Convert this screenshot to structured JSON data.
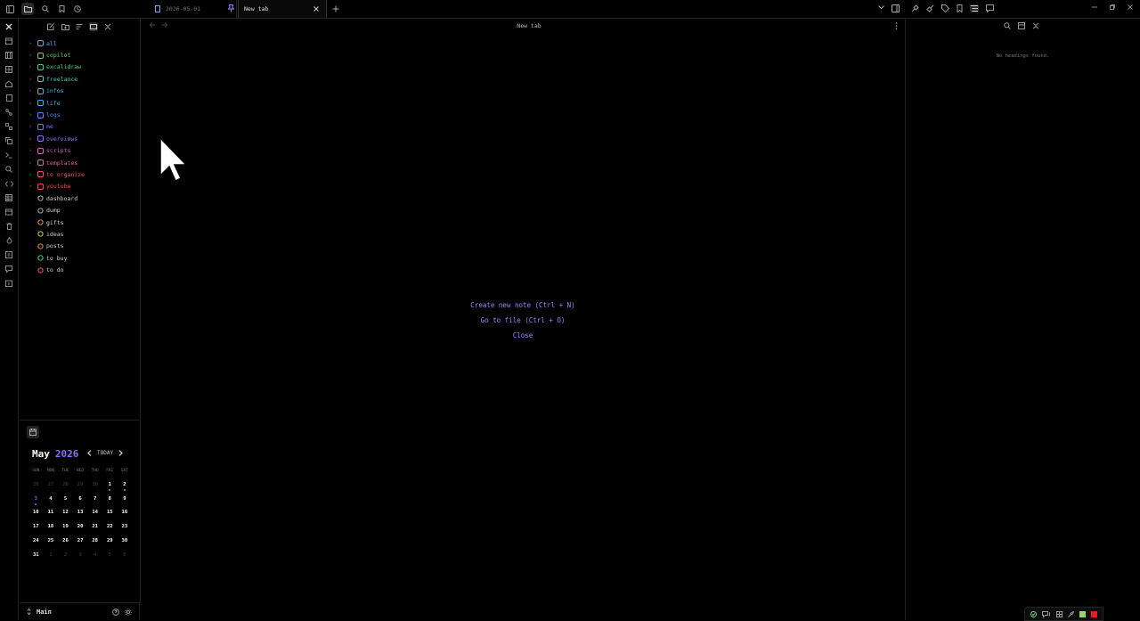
{
  "tabs": [
    {
      "label": "2026-05-01",
      "active": false
    },
    {
      "label": "New tab",
      "active": true
    }
  ],
  "main": {
    "title": "New tab",
    "actions": [
      "Create new note (Ctrl + N)",
      "Go to file (Ctrl + O)",
      "Close"
    ]
  },
  "explorer": {
    "folders": [
      {
        "label": "all",
        "color": "#3fb4f5",
        "icon": "globe-icon"
      },
      {
        "label": "copilot",
        "color": "#5fd17a",
        "icon": "folder-icon"
      },
      {
        "label": "excalidraw",
        "color": "#46d07a",
        "icon": "pencil-icon"
      },
      {
        "label": "freelance",
        "color": "#3ecfc1",
        "icon": "briefcase-icon"
      },
      {
        "label": "infos",
        "color": "#3fb4f5",
        "icon": "info-icon"
      },
      {
        "label": "life",
        "color": "#3fb4f5",
        "icon": "leaf-icon"
      },
      {
        "label": "logs",
        "color": "#4c8dff",
        "icon": "log-icon"
      },
      {
        "label": "me",
        "color": "#7b6cff",
        "icon": "person-icon"
      },
      {
        "label": "overviews",
        "color": "#9a6cff",
        "icon": "mountain-icon"
      },
      {
        "label": "scripts",
        "color": "#d75ed4",
        "icon": "code-icon"
      },
      {
        "label": "templates",
        "color": "#f15ba0",
        "icon": "template-icon"
      },
      {
        "label": "to organize",
        "color": "#f5506f",
        "icon": "shuffle-icon"
      },
      {
        "label": "youtube",
        "color": "#f24848",
        "icon": "video-icon"
      }
    ],
    "files": [
      {
        "label": "dashboard",
        "icon": "dashboard-icon",
        "icon_color": "#aaaaaa"
      },
      {
        "label": "dump",
        "icon": "speech-icon",
        "icon_color": "#aaaaaa"
      },
      {
        "label": "gifts",
        "icon": "gift-icon",
        "icon_color": "#f08a3a"
      },
      {
        "label": "ideas",
        "icon": "bulb-icon",
        "icon_color": "#d6c13a"
      },
      {
        "label": "posts",
        "icon": "at-icon",
        "icon_color": "#f08a3a"
      },
      {
        "label": "to buy",
        "icon": "receipt-icon",
        "icon_color": "#3fcf6b"
      },
      {
        "label": "to do",
        "icon": "target-icon",
        "icon_color": "#f5506f"
      }
    ],
    "file_color": "#cfcfcf"
  },
  "calendar": {
    "month": "May",
    "year": "2026",
    "today_label": "TODAY",
    "weekdays": [
      "SUN",
      "MON",
      "TUE",
      "WED",
      "THU",
      "FRI",
      "SAT"
    ],
    "weeks": [
      [
        "26",
        "27",
        "28",
        "29",
        "30",
        "1",
        "2"
      ],
      [
        "3",
        "4",
        "5",
        "6",
        "7",
        "8",
        "9"
      ],
      [
        "10",
        "11",
        "12",
        "13",
        "14",
        "15",
        "16"
      ],
      [
        "17",
        "18",
        "19",
        "20",
        "21",
        "22",
        "23"
      ],
      [
        "24",
        "25",
        "26",
        "27",
        "28",
        "29",
        "30"
      ],
      [
        "31",
        "1",
        "2",
        "3",
        "4",
        "5",
        "6"
      ]
    ]
  },
  "vault": {
    "name": "Main"
  },
  "outline": {
    "empty_text": "No headings found."
  },
  "colors": {
    "accent": "#8c6cff",
    "status_green": "#9bd36a",
    "status_red": "#e02020"
  }
}
